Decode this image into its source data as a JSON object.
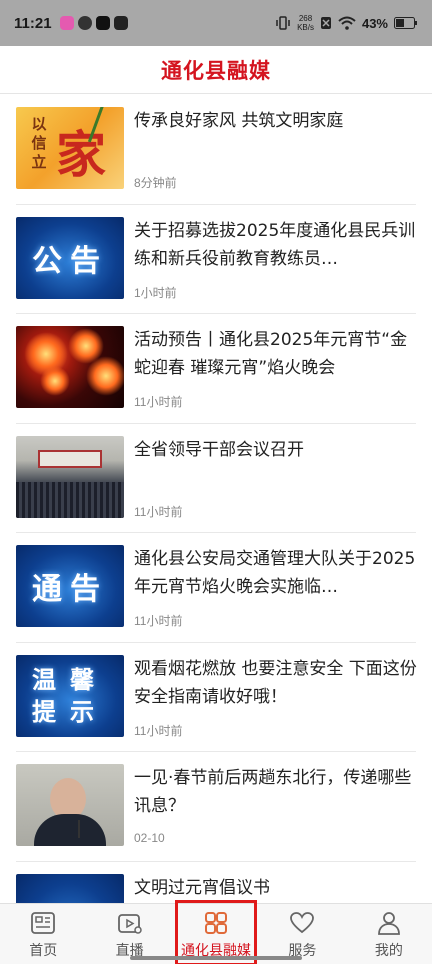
{
  "status_bar": {
    "time": "11:21",
    "speed_value": "268",
    "speed_unit": "KB/s",
    "battery": "43%"
  },
  "header": {
    "title": "通化县融媒"
  },
  "news": [
    {
      "title": "传承良好家风 共筑文明家庭",
      "time": "8分钟前"
    },
    {
      "title": "关于招募选拔2025年度通化县民兵训练和新兵役前教育教练员…",
      "time": "1小时前"
    },
    {
      "title": "活动预告丨通化县2025年元宵节“金蛇迎春 璀璨元宵”焰火晚会",
      "time": "11小时前"
    },
    {
      "title": "全省领导干部会议召开",
      "time": "11小时前"
    },
    {
      "title": "通化县公安局交通管理大队关于2025年元宵节焰火晚会实施临…",
      "time": "11小时前"
    },
    {
      "title": "观看烟花燃放 也要注意安全 下面这份安全指南请收好哦！",
      "time": "11小时前"
    },
    {
      "title": "一见·春节前后两趟东北行，传递哪些讯息？",
      "time": "02-10"
    },
    {
      "title": "文明过元宵倡议书",
      "time": ""
    }
  ],
  "thumbs": {
    "family_seal": "以信立",
    "family_big": "家",
    "notice1": "公告",
    "notice2": "通告",
    "warm_line1": "温馨",
    "warm_line2": "提示"
  },
  "nav": [
    {
      "label": "首页",
      "icon": "news-icon"
    },
    {
      "label": "直播",
      "icon": "live-icon"
    },
    {
      "label": "通化县融媒",
      "icon": "grid-icon",
      "active": true
    },
    {
      "label": "服务",
      "icon": "heart-icon"
    },
    {
      "label": "我的",
      "icon": "user-icon"
    }
  ],
  "colors": {
    "brand": "#d4141f",
    "highlight_box": "#e01a1a"
  }
}
